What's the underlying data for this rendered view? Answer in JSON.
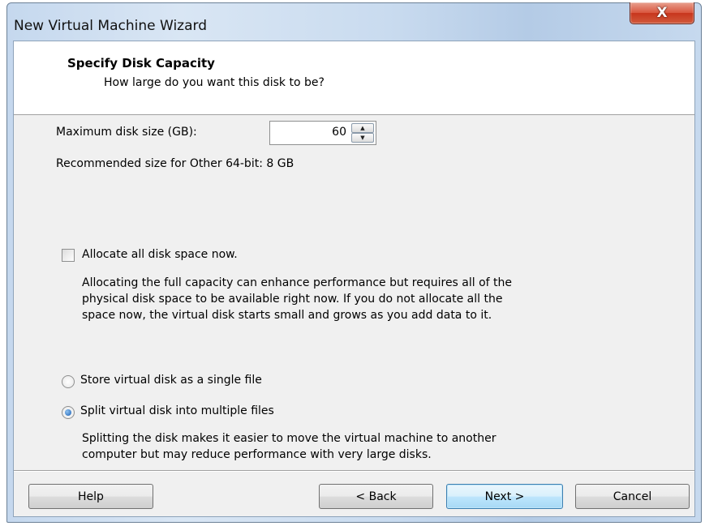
{
  "window": {
    "title": "New Virtual Machine Wizard",
    "close_glyph": "X"
  },
  "header": {
    "title": "Specify Disk Capacity",
    "subtitle": "How large do you want this disk to be?"
  },
  "disk_size": {
    "label": "Maximum disk size (GB):",
    "value": "60",
    "recommended": "Recommended size for Other 64-bit: 8 GB"
  },
  "allocate": {
    "label": "Allocate all disk space now.",
    "checked": false,
    "description": "Allocating the full capacity can enhance performance but requires all of the\nphysical disk space to be available right now. If you do not allocate all the\nspace now, the virtual disk starts small and grows as you add data to it."
  },
  "storage_options": {
    "single_label": "Store virtual disk as a single file",
    "multiple_label": "Split virtual disk into multiple files",
    "selected": "multiple",
    "description": "Splitting the disk makes it easier to move the virtual machine to another\ncomputer but may reduce performance with very large disks."
  },
  "buttons": {
    "help": "Help",
    "back": "< Back",
    "next": "Next >",
    "cancel": "Cancel"
  },
  "colors": {
    "accent": "#3c7fb1",
    "close_button": "#c8361d",
    "dialog_background": "#f0f0f0"
  }
}
